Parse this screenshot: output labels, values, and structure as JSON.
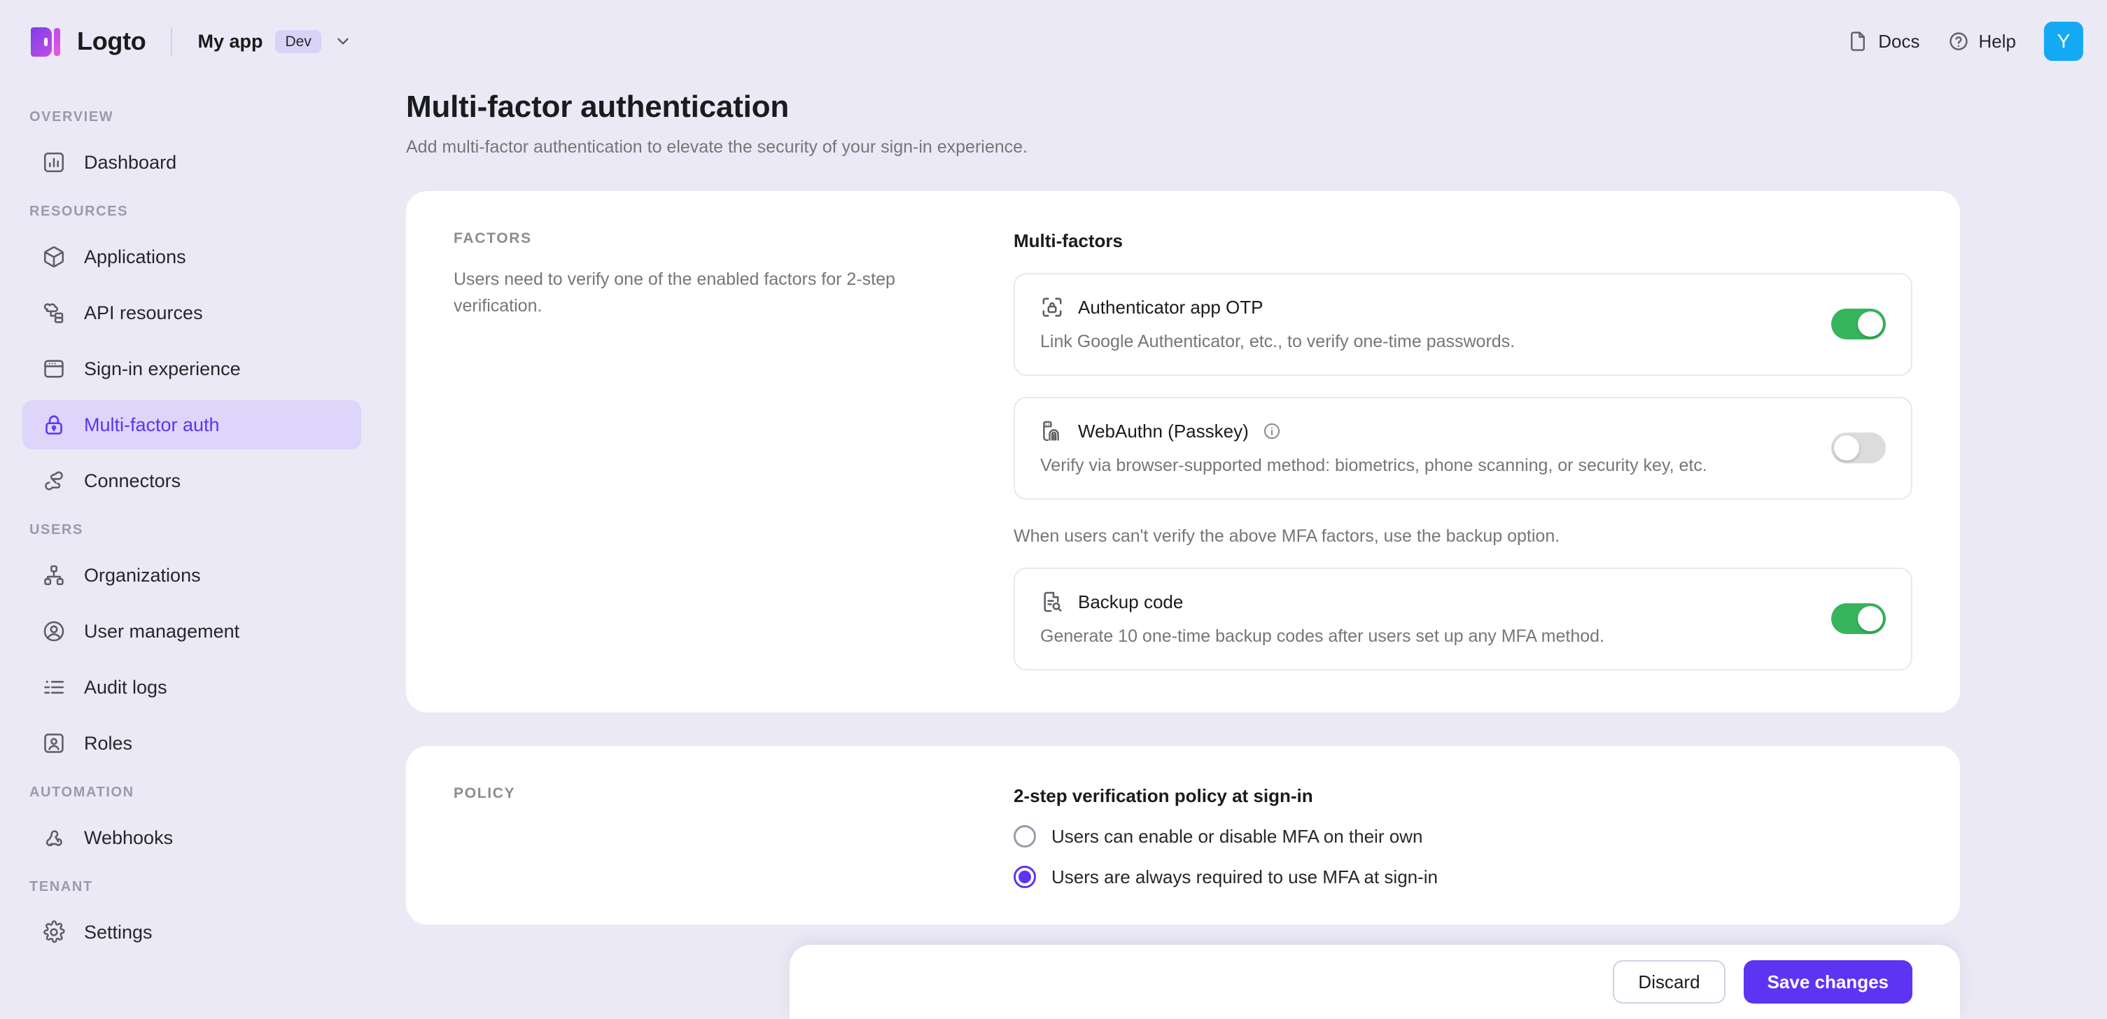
{
  "header": {
    "brand": "Logto",
    "tenant_name": "My app",
    "tenant_badge": "Dev",
    "docs_label": "Docs",
    "help_label": "Help",
    "avatar_initial": "Y"
  },
  "sidebar": {
    "sections": [
      {
        "label": "Overview",
        "items": [
          {
            "label": "Dashboard",
            "icon": "chart-box-icon",
            "active": false
          }
        ]
      },
      {
        "label": "Resources",
        "items": [
          {
            "label": "Applications",
            "icon": "cube-icon",
            "active": false
          },
          {
            "label": "API resources",
            "icon": "api-nodes-icon",
            "active": false
          },
          {
            "label": "Sign-in experience",
            "icon": "browser-window-icon",
            "active": false
          },
          {
            "label": "Multi-factor auth",
            "icon": "lock-icon",
            "active": true
          },
          {
            "label": "Connectors",
            "icon": "connectors-icon",
            "active": false
          }
        ]
      },
      {
        "label": "Users",
        "items": [
          {
            "label": "Organizations",
            "icon": "org-tree-icon",
            "active": false
          },
          {
            "label": "User management",
            "icon": "user-circle-icon",
            "active": false
          },
          {
            "label": "Audit logs",
            "icon": "list-icon",
            "active": false
          },
          {
            "label": "Roles",
            "icon": "user-box-icon",
            "active": false
          }
        ]
      },
      {
        "label": "Automation",
        "items": [
          {
            "label": "Webhooks",
            "icon": "webhook-icon",
            "active": false
          }
        ]
      },
      {
        "label": "Tenant",
        "items": [
          {
            "label": "Settings",
            "icon": "gear-icon",
            "active": false
          }
        ]
      }
    ]
  },
  "page": {
    "title": "Multi-factor authentication",
    "subtitle": "Add multi-factor authentication to elevate the security of your sign-in experience."
  },
  "factors_card": {
    "section_label": "Factors",
    "section_desc": "Users need to verify one of the enabled factors for 2-step verification.",
    "field_title": "Multi-factors",
    "items": [
      {
        "name": "Authenticator app OTP",
        "desc": "Link Google Authenticator, etc., to verify one-time passwords.",
        "icon": "scan-lock-icon",
        "enabled": true,
        "has_info": false
      },
      {
        "name": "WebAuthn (Passkey)",
        "desc": "Verify via browser-supported method: biometrics, phone scanning, or security key, etc.",
        "icon": "security-key-fingerprint-icon",
        "enabled": false,
        "has_info": true
      }
    ],
    "backup_note": "When users can't verify the above MFA factors, use the backup option.",
    "backup": {
      "name": "Backup code",
      "desc": "Generate 10 one-time backup codes after users set up any MFA method.",
      "icon": "document-search-icon",
      "enabled": true
    }
  },
  "policy_card": {
    "section_label": "Policy",
    "field_title": "2-step verification policy at sign-in",
    "options": [
      {
        "label": "Users can enable or disable MFA on their own",
        "selected": false
      },
      {
        "label": "Users are always required to use MFA at sign-in",
        "selected": true
      }
    ]
  },
  "footer": {
    "discard_label": "Discard",
    "save_label": "Save changes"
  },
  "colors": {
    "accent": "#5D34F2",
    "accent_soft": "#DDD5FA",
    "toggle_on": "#36B55C",
    "toggle_off": "#DCDCDC",
    "page_bg": "#EBE9F5",
    "avatar_bg": "#14A9F5"
  }
}
